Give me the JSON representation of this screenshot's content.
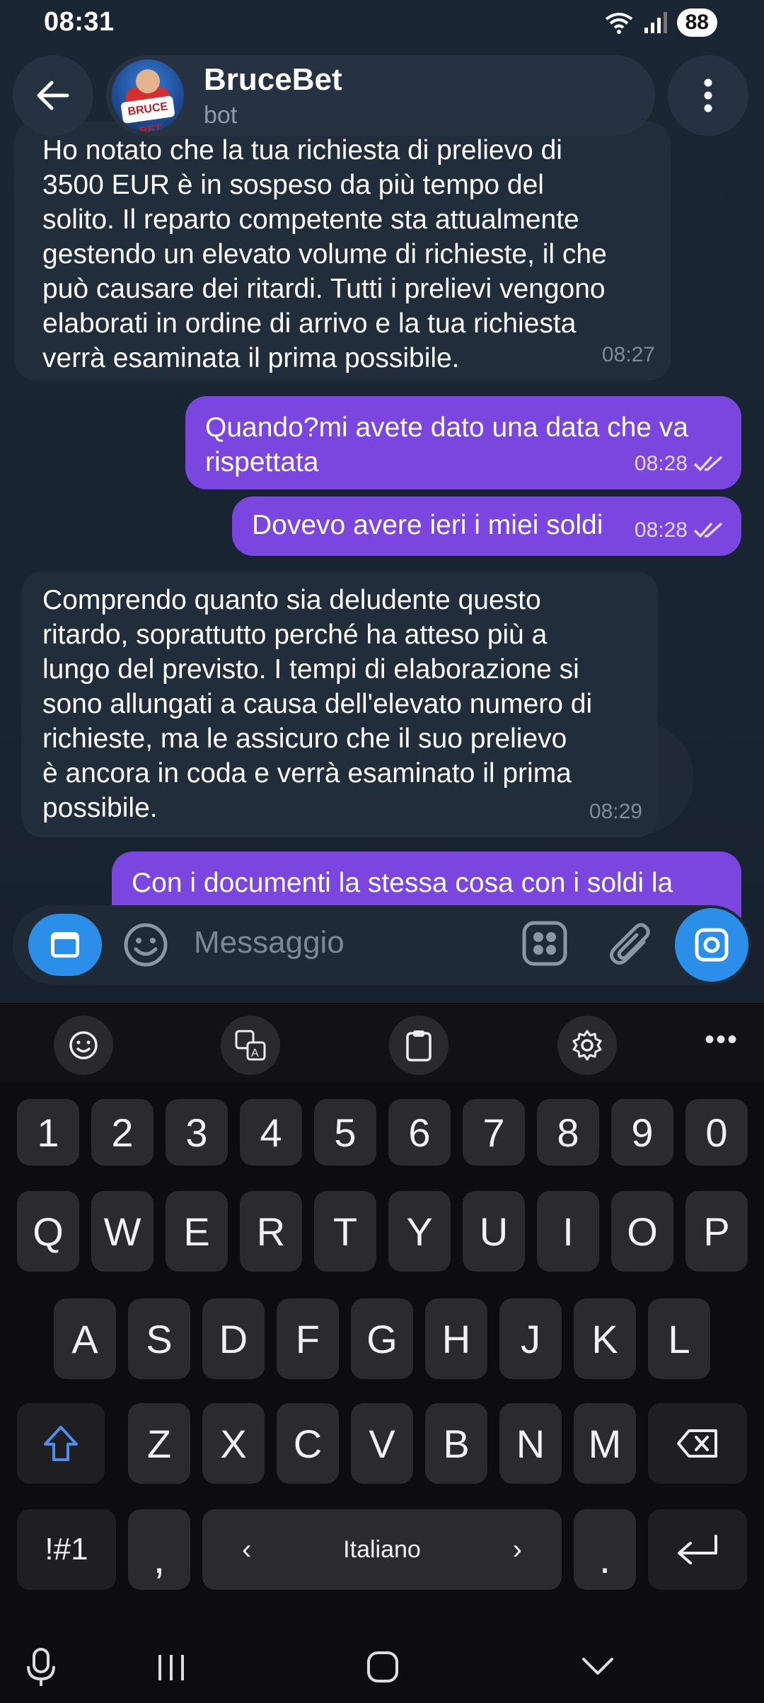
{
  "status": {
    "time": "08:31",
    "battery": "88"
  },
  "header": {
    "title": "BruceBet",
    "subtitle": "bot",
    "avatar_text": "BRUCE BET"
  },
  "messages": [
    {
      "direction": "in",
      "text": "Ho notato che la tua richiesta di prelievo di\n3500 EUR è in sospeso da più tempo del\nsolito. Il reparto competente sta attualmente\ngestendo un elevato volume di richieste, il che\npuò causare dei ritardi. Tutti i prelievi vengono\nelaborati in ordine di arrivo e la tua richiesta\nverrà esaminata il prima possibile.",
      "time": "08:27"
    },
    {
      "direction": "out",
      "text": "Quando?mi avete dato una data che va\nrispettata",
      "time": "08:28"
    },
    {
      "direction": "out",
      "text": "Dovevo avere ieri i miei soldi",
      "time": "08:28"
    },
    {
      "direction": "in",
      "text": "Comprendo quanto sia deludente questo\nritardo, soprattutto perché ha atteso più a\nlungo del previsto. I tempi di elaborazione si\nsono allungati a causa dell'elevato numero di\nrichieste, ma le assicuro che il suo prelievo\nè ancora in coda e verrà esaminato il prima\npossibile.",
      "time": "08:29"
    },
    {
      "direction": "out",
      "text": "Con i documenti la stessa cosa con i soldi la",
      "time": ""
    }
  ],
  "input": {
    "placeholder": "Messaggio"
  },
  "keyboard": {
    "numbers": [
      "1",
      "2",
      "3",
      "4",
      "5",
      "6",
      "7",
      "8",
      "9",
      "0"
    ],
    "row1": [
      "Q",
      "W",
      "E",
      "R",
      "T",
      "Y",
      "U",
      "I",
      "O",
      "P"
    ],
    "row2": [
      "A",
      "S",
      "D",
      "F",
      "G",
      "H",
      "J",
      "K",
      "L"
    ],
    "row3": [
      "Z",
      "X",
      "C",
      "V",
      "B",
      "N",
      "M"
    ],
    "symbols_key": "!#1",
    "comma_key": ",",
    "space_label": "Italiano",
    "period_key": "."
  },
  "colors": {
    "accent": "#2b8ee8",
    "outgoing_bubble": "#7b46e0",
    "incoming_bubble": "#212d3b"
  }
}
